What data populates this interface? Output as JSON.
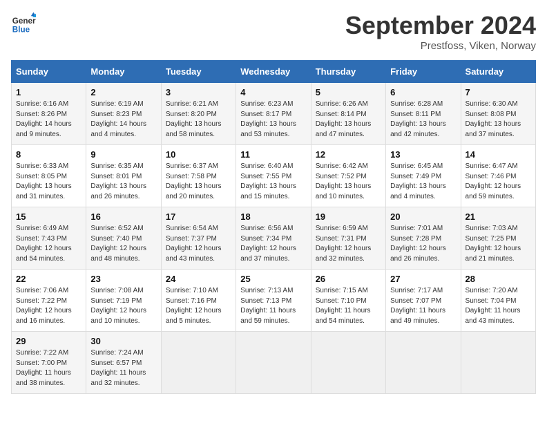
{
  "header": {
    "logo_line1": "General",
    "logo_line2": "Blue",
    "month_title": "September 2024",
    "location": "Prestfoss, Viken, Norway"
  },
  "weekdays": [
    "Sunday",
    "Monday",
    "Tuesday",
    "Wednesday",
    "Thursday",
    "Friday",
    "Saturday"
  ],
  "weeks": [
    [
      {
        "day": "1",
        "sunrise": "6:16 AM",
        "sunset": "8:26 PM",
        "daylight": "14 hours and 9 minutes."
      },
      {
        "day": "2",
        "sunrise": "6:19 AM",
        "sunset": "8:23 PM",
        "daylight": "14 hours and 4 minutes."
      },
      {
        "day": "3",
        "sunrise": "6:21 AM",
        "sunset": "8:20 PM",
        "daylight": "13 hours and 58 minutes."
      },
      {
        "day": "4",
        "sunrise": "6:23 AM",
        "sunset": "8:17 PM",
        "daylight": "13 hours and 53 minutes."
      },
      {
        "day": "5",
        "sunrise": "6:26 AM",
        "sunset": "8:14 PM",
        "daylight": "13 hours and 47 minutes."
      },
      {
        "day": "6",
        "sunrise": "6:28 AM",
        "sunset": "8:11 PM",
        "daylight": "13 hours and 42 minutes."
      },
      {
        "day": "7",
        "sunrise": "6:30 AM",
        "sunset": "8:08 PM",
        "daylight": "13 hours and 37 minutes."
      }
    ],
    [
      {
        "day": "8",
        "sunrise": "6:33 AM",
        "sunset": "8:05 PM",
        "daylight": "13 hours and 31 minutes."
      },
      {
        "day": "9",
        "sunrise": "6:35 AM",
        "sunset": "8:01 PM",
        "daylight": "13 hours and 26 minutes."
      },
      {
        "day": "10",
        "sunrise": "6:37 AM",
        "sunset": "7:58 PM",
        "daylight": "13 hours and 20 minutes."
      },
      {
        "day": "11",
        "sunrise": "6:40 AM",
        "sunset": "7:55 PM",
        "daylight": "13 hours and 15 minutes."
      },
      {
        "day": "12",
        "sunrise": "6:42 AM",
        "sunset": "7:52 PM",
        "daylight": "13 hours and 10 minutes."
      },
      {
        "day": "13",
        "sunrise": "6:45 AM",
        "sunset": "7:49 PM",
        "daylight": "13 hours and 4 minutes."
      },
      {
        "day": "14",
        "sunrise": "6:47 AM",
        "sunset": "7:46 PM",
        "daylight": "12 hours and 59 minutes."
      }
    ],
    [
      {
        "day": "15",
        "sunrise": "6:49 AM",
        "sunset": "7:43 PM",
        "daylight": "12 hours and 54 minutes."
      },
      {
        "day": "16",
        "sunrise": "6:52 AM",
        "sunset": "7:40 PM",
        "daylight": "12 hours and 48 minutes."
      },
      {
        "day": "17",
        "sunrise": "6:54 AM",
        "sunset": "7:37 PM",
        "daylight": "12 hours and 43 minutes."
      },
      {
        "day": "18",
        "sunrise": "6:56 AM",
        "sunset": "7:34 PM",
        "daylight": "12 hours and 37 minutes."
      },
      {
        "day": "19",
        "sunrise": "6:59 AM",
        "sunset": "7:31 PM",
        "daylight": "12 hours and 32 minutes."
      },
      {
        "day": "20",
        "sunrise": "7:01 AM",
        "sunset": "7:28 PM",
        "daylight": "12 hours and 26 minutes."
      },
      {
        "day": "21",
        "sunrise": "7:03 AM",
        "sunset": "7:25 PM",
        "daylight": "12 hours and 21 minutes."
      }
    ],
    [
      {
        "day": "22",
        "sunrise": "7:06 AM",
        "sunset": "7:22 PM",
        "daylight": "12 hours and 16 minutes."
      },
      {
        "day": "23",
        "sunrise": "7:08 AM",
        "sunset": "7:19 PM",
        "daylight": "12 hours and 10 minutes."
      },
      {
        "day": "24",
        "sunrise": "7:10 AM",
        "sunset": "7:16 PM",
        "daylight": "12 hours and 5 minutes."
      },
      {
        "day": "25",
        "sunrise": "7:13 AM",
        "sunset": "7:13 PM",
        "daylight": "11 hours and 59 minutes."
      },
      {
        "day": "26",
        "sunrise": "7:15 AM",
        "sunset": "7:10 PM",
        "daylight": "11 hours and 54 minutes."
      },
      {
        "day": "27",
        "sunrise": "7:17 AM",
        "sunset": "7:07 PM",
        "daylight": "11 hours and 49 minutes."
      },
      {
        "day": "28",
        "sunrise": "7:20 AM",
        "sunset": "7:04 PM",
        "daylight": "11 hours and 43 minutes."
      }
    ],
    [
      {
        "day": "29",
        "sunrise": "7:22 AM",
        "sunset": "7:00 PM",
        "daylight": "11 hours and 38 minutes."
      },
      {
        "day": "30",
        "sunrise": "7:24 AM",
        "sunset": "6:57 PM",
        "daylight": "11 hours and 32 minutes."
      },
      null,
      null,
      null,
      null,
      null
    ]
  ]
}
